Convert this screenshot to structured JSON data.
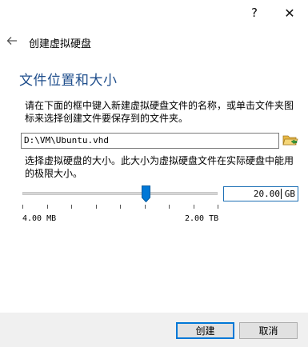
{
  "window": {
    "help_label": "?",
    "close_label": "✕"
  },
  "header": {
    "title": "创建虚拟硬盘"
  },
  "section": {
    "title": "文件位置和大小"
  },
  "location": {
    "description": "请在下面的框中键入新建虚拟硬盘文件的名称，或单击文件夹图标来选择创建文件要保存到的文件夹。",
    "path_value": "D:\\VM\\Ubuntu.vhd",
    "folder_icon": "folder-open-icon"
  },
  "size": {
    "description": "选择虚拟硬盘的大小。此大小为虚拟硬盘文件在实际硬盘中能用的极限大小。",
    "value": "20.00",
    "unit": "GB",
    "min_label": "4.00 MB",
    "max_label": "2.00 TB",
    "slider_fraction": 0.63
  },
  "buttons": {
    "create": "创建",
    "cancel": "取消"
  },
  "colors": {
    "accent": "#0078d7",
    "section_title": "#1f4e8c"
  }
}
